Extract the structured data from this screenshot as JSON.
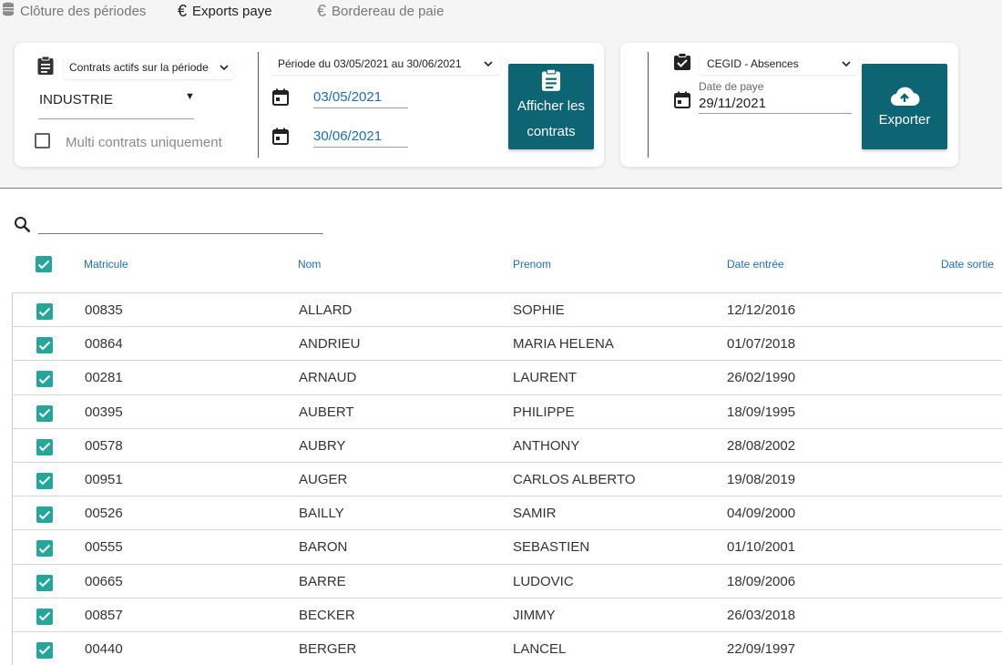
{
  "tabs": [
    {
      "label": "Clôture des périodes",
      "icon": "coins-icon",
      "active": false
    },
    {
      "label": "Exports paye",
      "icon": "euro-icon",
      "active": true
    },
    {
      "label": "Bordereau de paie",
      "icon": "euro-icon",
      "active": false
    }
  ],
  "filters": {
    "contract_type": "Contrats actifs sur la période",
    "sector": "INDUSTRIE",
    "multi_contracts_label": "Multi contrats uniquement",
    "multi_contracts_checked": false,
    "period_select": "Période du 03/05/2021 au 30/06/2021",
    "start_date": "03/05/2021",
    "end_date": "30/06/2021",
    "show_button_line1": "Afficher les",
    "show_button_line2": "contrats"
  },
  "export": {
    "format": "CEGID - Absences",
    "pay_date_label": "Date de paye",
    "pay_date": "29/11/2021",
    "button_label": "Exporter"
  },
  "search": {
    "value": ""
  },
  "table": {
    "headers": [
      "Matricule",
      "Nom",
      "Prenom",
      "Date entrée",
      "Date sortie"
    ],
    "rows": [
      {
        "matricule": "00835",
        "nom": "ALLARD",
        "prenom": "SOPHIE",
        "date_entree": "12/12/2016",
        "date_sortie": ""
      },
      {
        "matricule": "00864",
        "nom": "ANDRIEU",
        "prenom": "MARIA HELENA",
        "date_entree": "01/07/2018",
        "date_sortie": ""
      },
      {
        "matricule": "00281",
        "nom": "ARNAUD",
        "prenom": "LAURENT",
        "date_entree": "26/02/1990",
        "date_sortie": ""
      },
      {
        "matricule": "00395",
        "nom": "AUBERT",
        "prenom": "PHILIPPE",
        "date_entree": "18/09/1995",
        "date_sortie": ""
      },
      {
        "matricule": "00578",
        "nom": "AUBRY",
        "prenom": "ANTHONY",
        "date_entree": "28/08/2002",
        "date_sortie": ""
      },
      {
        "matricule": "00951",
        "nom": "AUGER",
        "prenom": "CARLOS ALBERTO",
        "date_entree": "19/08/2019",
        "date_sortie": ""
      },
      {
        "matricule": "00526",
        "nom": "BAILLY",
        "prenom": "SAMIR",
        "date_entree": "04/09/2000",
        "date_sortie": ""
      },
      {
        "matricule": "00555",
        "nom": "BARON",
        "prenom": "SEBASTIEN",
        "date_entree": "01/10/2001",
        "date_sortie": ""
      },
      {
        "matricule": "00665",
        "nom": "BARRE",
        "prenom": "LUDOVIC",
        "date_entree": "18/09/2006",
        "date_sortie": ""
      },
      {
        "matricule": "00857",
        "nom": "BECKER",
        "prenom": "JIMMY",
        "date_entree": "26/03/2018",
        "date_sortie": ""
      },
      {
        "matricule": "00440",
        "nom": "BERGER",
        "prenom": "LANCEL",
        "date_entree": "22/09/1997",
        "date_sortie": ""
      }
    ]
  },
  "colors": {
    "accent": "#0d6472",
    "checkbox": "#26a69a",
    "link": "#1e6fb3"
  }
}
